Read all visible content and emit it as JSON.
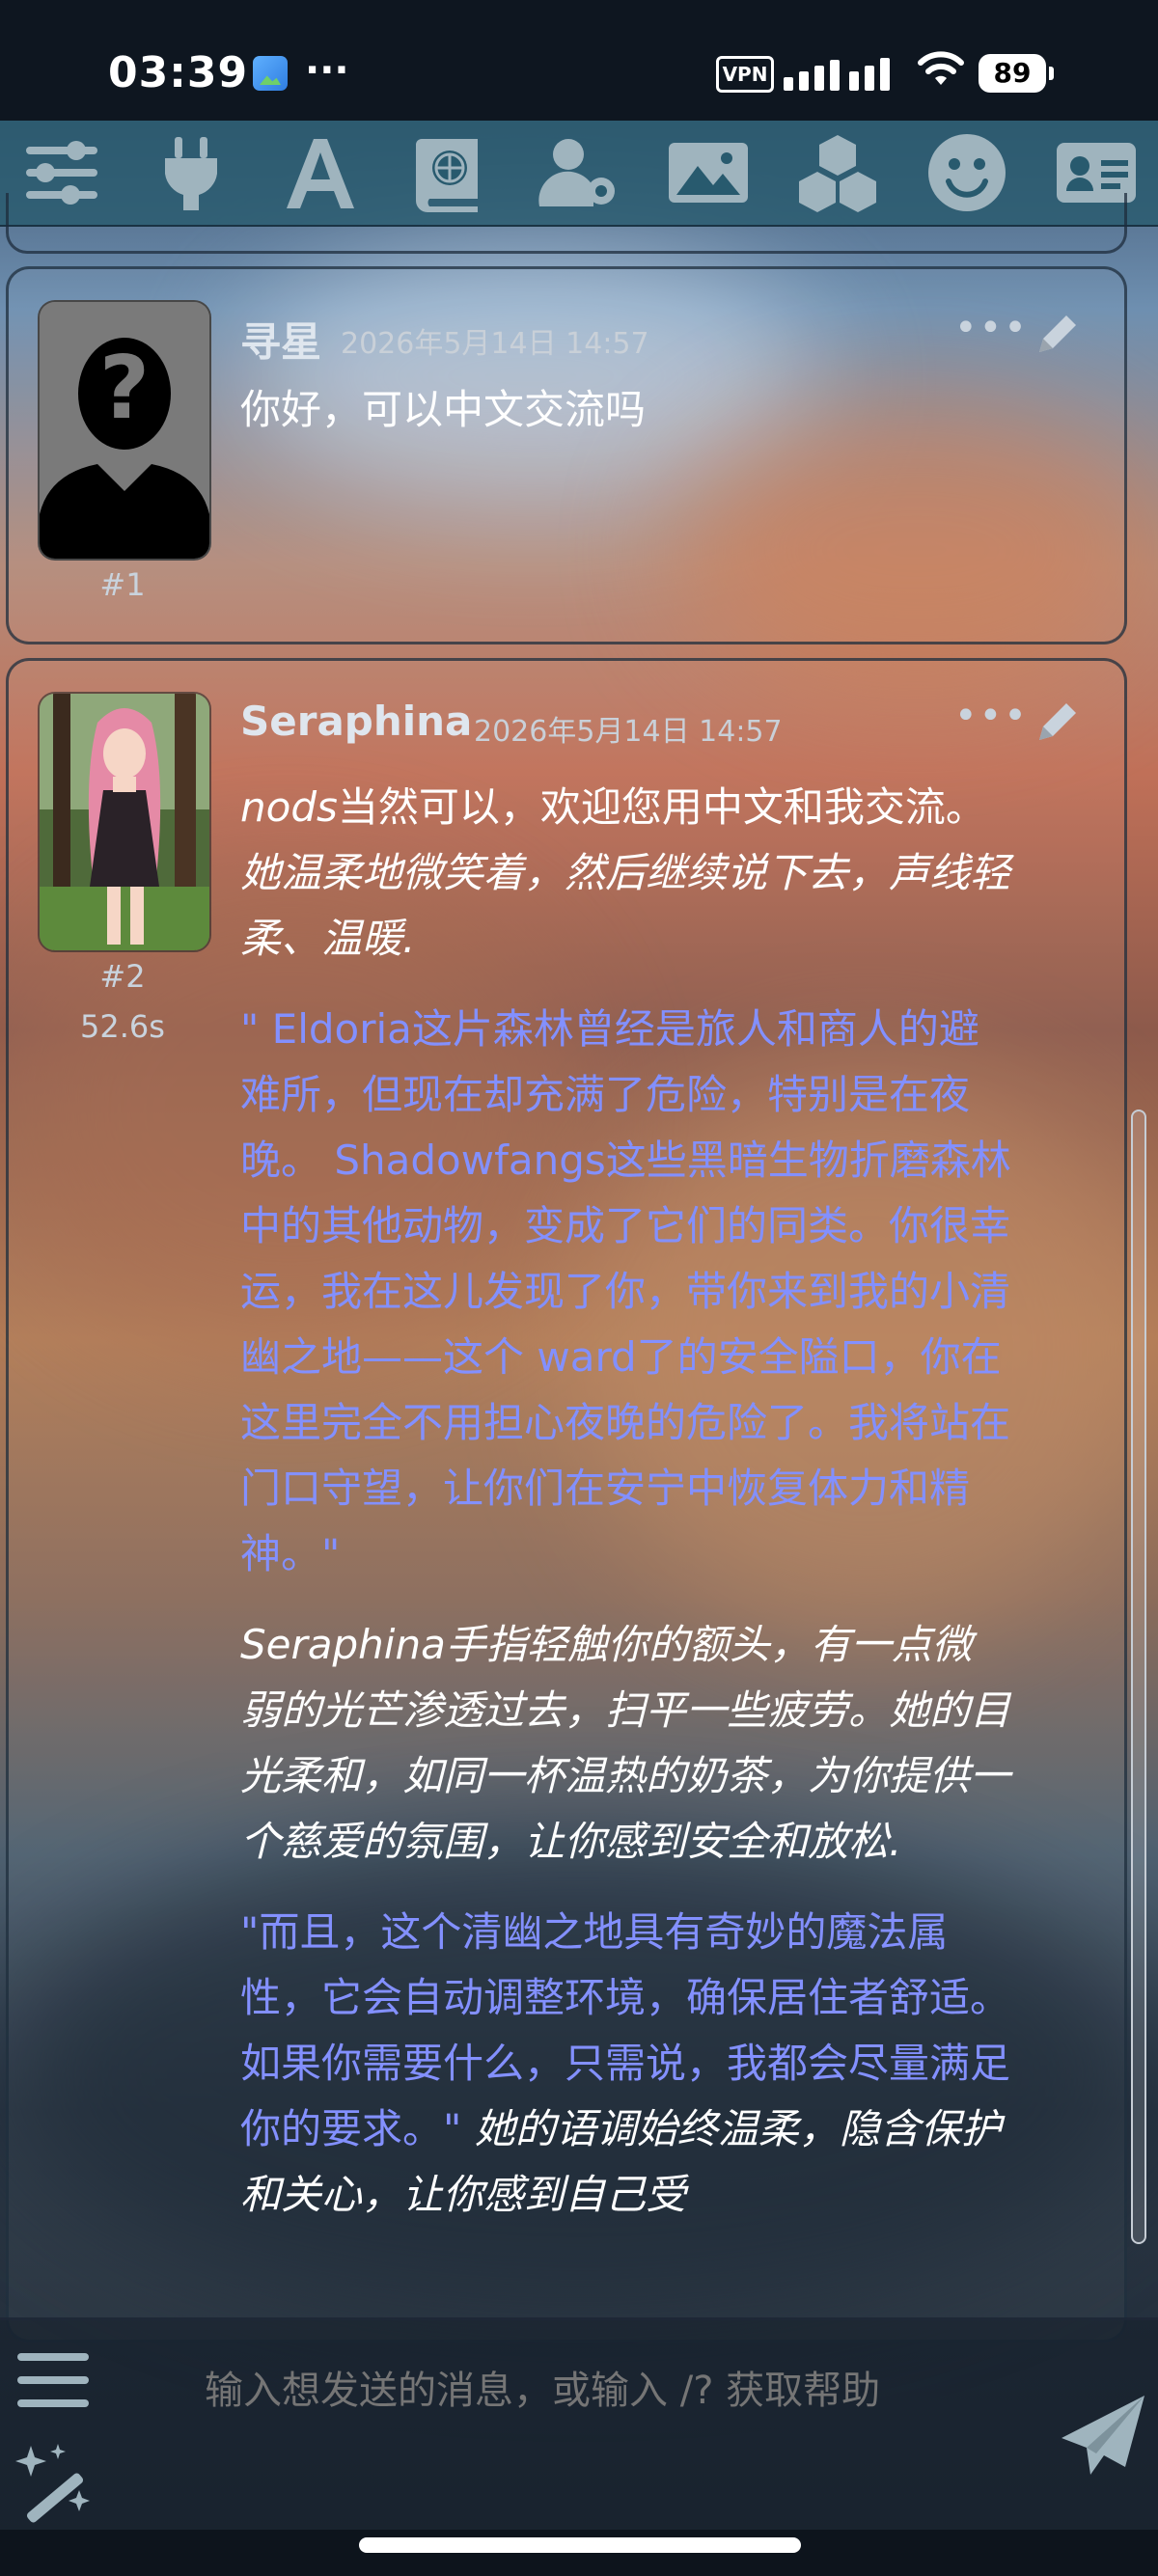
{
  "status_bar": {
    "time": "03:39",
    "more": "···",
    "vpn": "VPN",
    "battery": "89"
  },
  "toolbar": {
    "items": [
      {
        "icon": "sliders-icon"
      },
      {
        "icon": "plug-icon"
      },
      {
        "icon": "font-icon"
      },
      {
        "icon": "book-globe-icon"
      },
      {
        "icon": "user-gear-icon"
      },
      {
        "icon": "image-icon"
      },
      {
        "icon": "cubes-icon"
      },
      {
        "icon": "smile-icon"
      },
      {
        "icon": "id-card-icon"
      }
    ]
  },
  "messages": [
    {
      "author": "寻星",
      "timestamp": "2026年5月14日 14:57",
      "mes_id": "#1",
      "text": "你好，可以中文交流吗"
    },
    {
      "author": "Seraphina",
      "timestamp": "2026年5月14日 14:57",
      "mes_id": "#2",
      "timer": "52.6s",
      "p1_nods": "nods",
      "p1_plain": "当然可以，欢迎您用中文和我交流。",
      "p1_narr": "她温柔地微笑着，然后继续说下去，声线轻柔、温暖.",
      "p2_quote": "\" Eldoria这片森林曾经是旅人和商人的避难所，但现在却充满了危险，特别是在夜晚。 Shadowfangs这些黑暗生物折磨森林中的其他动物，变成了它们的同类。你很幸运，我在这儿发现了你，带你来到我的小清幽之地——这个 ward了的安全隘口，你在这里完全不用担心夜晚的危险了。我将站在门口守望，让你们在安宁中恢复体力和精神。\"",
      "p3_narr": "Seraphina手指轻触你的额头，有一点微弱的光芒渗透过去，扫平一些疲劳。她的目光柔和，如同一杯温热的奶茶，为你提供一个慈爱的氛围，让你感到安全和放松.",
      "p4_quote": "\"而且，这个清幽之地具有奇妙的魔法属性，它会自动调整环境，确保居住者舒适。如果你需要什么，只需说，我都会尽量满足你的要求。\"",
      "p4_narr": "她的语调始终温柔，隐含保护和关心，让你感到自己受"
    }
  ],
  "input": {
    "placeholder": "输入想发送的消息，或输入 /? 获取帮助"
  },
  "colors": {
    "quote": "#8390ff",
    "toolbar_bg": "#285a6e",
    "icon": "#9fb4be"
  }
}
